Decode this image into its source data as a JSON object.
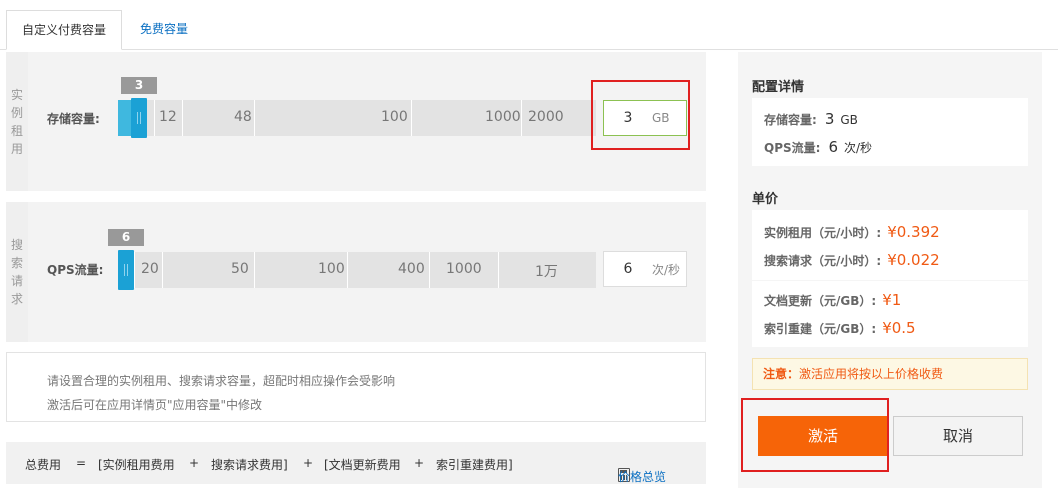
{
  "tabs": [
    {
      "label": "自定义付费容量",
      "active": true
    },
    {
      "label": "免费容量",
      "active": false
    }
  ],
  "instance": {
    "section_label": [
      "实",
      "例",
      "租",
      "用"
    ],
    "row_label": "存储容量:",
    "value": "3",
    "unit": "GB",
    "ticks": [
      "12",
      "48",
      "100",
      "1000",
      "2000"
    ]
  },
  "qps": {
    "section_label": [
      "搜",
      "索",
      "请",
      "求"
    ],
    "row_label": "QPS流量:",
    "value": "6",
    "unit": "次/秒",
    "ticks": [
      "20",
      "50",
      "100",
      "400",
      "1000",
      "1万"
    ]
  },
  "notes": {
    "line1": "请设置合理的实例租用、搜索请求容量，超配时相应操作会受影响",
    "line2": "激活后可在应用详情页\"应用容量\"中修改"
  },
  "formula": {
    "total": "总费用",
    "eq": "=",
    "part1": "[实例租用费用",
    "plus1": "+",
    "part2": "搜索请求费用]",
    "plus2": "+",
    "part3": "[文档更新费用",
    "plus3": "+",
    "part4": "索引重建费用]",
    "price_overview": "价格总览",
    "price_overview_icon": "calculator-icon"
  },
  "config": {
    "title": "配置详情",
    "storage_label": "存储容量:",
    "storage_value": "3",
    "storage_unit": "GB",
    "qps_label": "QPS流量:",
    "qps_value": "6",
    "qps_unit": "次/秒"
  },
  "pricing": {
    "title": "单价",
    "instance_label": "实例租用（元/小时）:",
    "instance_price": "¥0.392",
    "search_label": "搜索请求（元/小时）:",
    "search_price": "¥0.022",
    "doc_label": "文档更新（元/GB）:",
    "doc_price": "¥1",
    "reindex_label": "索引重建（元/GB）:",
    "reindex_price": "¥0.5"
  },
  "notice": {
    "bold": "注意：",
    "text": "激活应用将按以上价格收费"
  },
  "buttons": {
    "activate": "激活",
    "cancel": "取消"
  },
  "colors": {
    "accent_orange": "#f66408",
    "link_blue": "#0a6fc2",
    "slider_blue": "#1ba1d5",
    "price_orange": "#f05a14",
    "highlight_red": "#e02020"
  }
}
